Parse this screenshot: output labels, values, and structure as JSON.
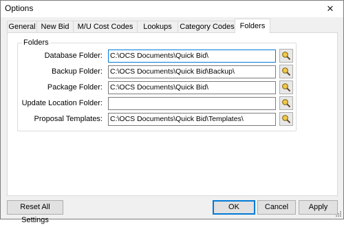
{
  "window": {
    "title": "Options",
    "close_glyph": "✕"
  },
  "tabs": [
    {
      "label": "General",
      "active": false
    },
    {
      "label": "New Bid",
      "active": false
    },
    {
      "label": "M/U Cost Codes",
      "active": false
    },
    {
      "label": "Lookups",
      "active": false
    },
    {
      "label": "Category Codes",
      "active": false
    },
    {
      "label": "Folders",
      "active": true
    }
  ],
  "folders_group": {
    "title": "Folders",
    "rows": [
      {
        "label": "Database Folder:",
        "value": "C:\\OCS Documents\\Quick Bid\\",
        "icon": "magnifier-icon"
      },
      {
        "label": "Backup Folder:",
        "value": "C:\\OCS Documents\\Quick Bid\\Backup\\",
        "icon": "magnifier-icon"
      },
      {
        "label": "Package Folder:",
        "value": "C:\\OCS Documents\\Quick Bid\\",
        "icon": "magnifier-icon"
      },
      {
        "label": "Update Location Folder:",
        "value": "",
        "icon": "magnifier-icon"
      },
      {
        "label": "Proposal Templates:",
        "value": "C:\\OCS Documents\\Quick Bid\\Templates\\",
        "icon": "magnifier-icon"
      }
    ]
  },
  "buttons": {
    "reset": "Reset All Settings",
    "ok": "OK",
    "cancel": "Cancel",
    "apply": "Apply"
  },
  "colors": {
    "focus_border": "#0078d7",
    "magnifier_lens": "#f2c94c"
  }
}
